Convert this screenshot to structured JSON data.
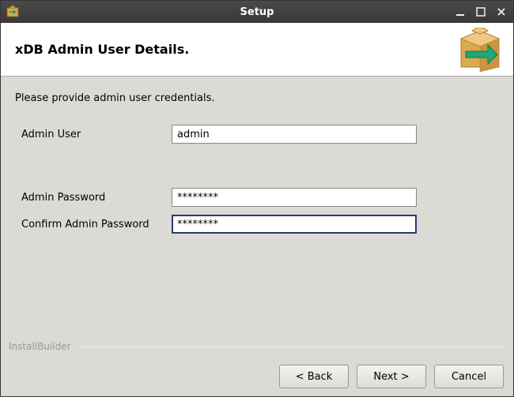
{
  "window": {
    "title": "Setup"
  },
  "header": {
    "title": "xDB Admin User Details."
  },
  "content": {
    "instruction": "Please provide admin user credentials.",
    "fields": {
      "admin_user": {
        "label": "Admin User",
        "value": "admin"
      },
      "admin_password": {
        "label": "Admin Password",
        "value": "********"
      },
      "confirm_password": {
        "label": "Confirm Admin Password",
        "value": "********"
      }
    }
  },
  "branding": "InstallBuilder",
  "footer": {
    "back": "< Back",
    "next": "Next >",
    "cancel": "Cancel"
  }
}
